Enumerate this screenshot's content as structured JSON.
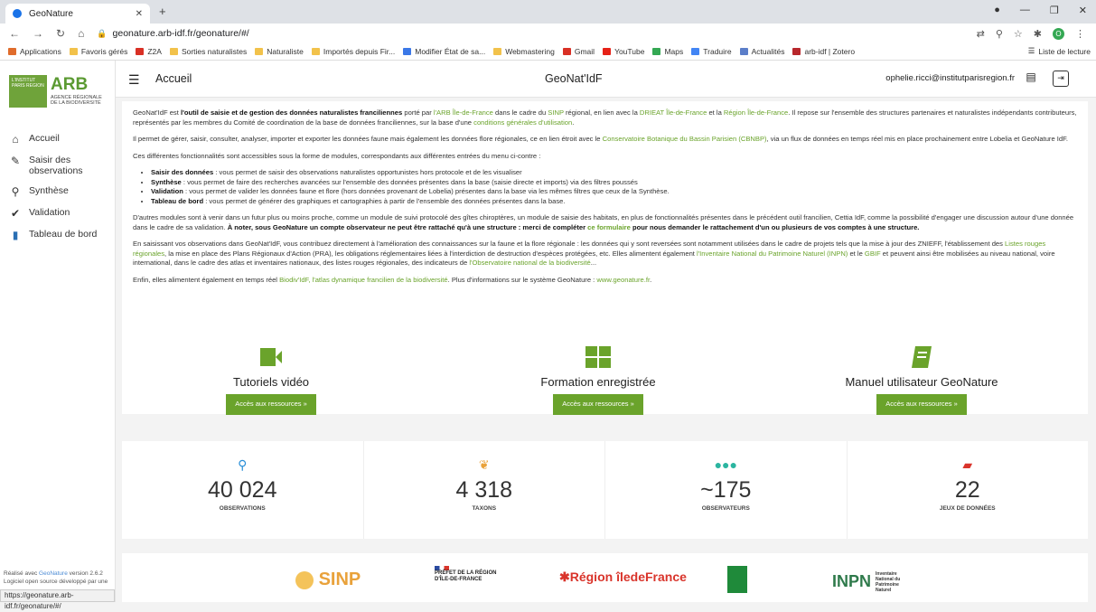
{
  "browser": {
    "tab_title": "GeoNature",
    "url": "geonature.arb-idf.fr/geonature/#/",
    "status_url": "https://geonature.arb-idf.fr/geonature/#/",
    "bookmarks": [
      "Applications",
      "Favoris gérés",
      "Z2A",
      "Sorties naturalistes",
      "Naturaliste",
      "Importés depuis Fir...",
      "Modifier État de sa...",
      "Webmastering",
      "Gmail",
      "YouTube",
      "Maps",
      "Traduire",
      "Actualités",
      "arb-idf | Zotero"
    ],
    "reading_list": "Liste de lecture"
  },
  "logo": {
    "box": "L'INSTITUT PARIS REGION",
    "arb": "ARB",
    "sub": "AGENCE RÉGIONALE DE LA BIODIVERSITÉ"
  },
  "menu": [
    "Accueil",
    "Saisir des observations",
    "Synthèse",
    "Validation",
    "Tableau de bord"
  ],
  "footer": {
    "line1_prefix": "Réalisé avec ",
    "line1_link": "GeoNature",
    "line1_suffix": " version 2.6.2",
    "line2": "Logiciel open source développé par une"
  },
  "topbar": {
    "crumb": "Accueil",
    "title": "GeoNat'IdF",
    "user": "ophelie.ricci@institutparisregion.fr"
  },
  "intro": {
    "p1a": "GeoNat'IdF est ",
    "p1b": "l'outil de saisie et de gestion des données naturalistes franciliennes",
    "p1c": " porté par ",
    "p1d": "l'ARB Île-de-France",
    "p1e": " dans le cadre du ",
    "p1f": "SINP",
    "p1g": " régional, en lien avec la ",
    "p1h": "DRIEAT Île-de-France",
    "p1i": " et la ",
    "p1j": "Région Île-de-France",
    "p1k": ". Il repose sur l'ensemble des structures partenaires et naturalistes indépendants contributeurs, représentés par les membres du Comité de coordination de la base de données franciliennes, sur la base d'une ",
    "p1l": "conditions générales d'utilisation",
    "p1m": ".",
    "p2a": "Il permet de gérer, saisir, consulter, analyser, importer et exporter les données faune mais également les données flore régionales, ce en lien étroit avec le ",
    "p2b": "Conservatoire Botanique du Bassin Parisien (CBNBP)",
    "p2c": ", via un flux de données en temps réel mis en place prochainement entre Lobelia et GeoNature IdF.",
    "p3": "Ces différentes fonctionnalités sont accessibles sous la forme de modules, correspondants aux différentes entrées du menu ci-contre :",
    "li": [
      [
        "Saisir des données",
        " : vous permet de saisir des observations naturalistes opportunistes hors protocole et de les visualiser"
      ],
      [
        "Synthèse",
        " : vous permet de faire des recherches avancées sur l'ensemble des données présentes dans la base (saisie directe et imports) via des filtres poussés"
      ],
      [
        "Validation",
        " : vous permet de valider les données faune et flore (hors données provenant de Lobelia) présentes dans la base via les mêmes filtres que ceux de la Synthèse."
      ],
      [
        "Tableau de bord",
        " : vous permet de générer des graphiques et cartographies à partir de l'ensemble des données présentes dans la base."
      ]
    ],
    "p4a": "D'autres modules sont à venir dans un futur plus ou moins proche, comme un module de suivi protocolé des gîtes chiroptères, un module de saisie des habitats, en plus de fonctionnalités présentes dans le précédent outil francilien, Cettia IdF, comme la possibilité d'engager une discussion autour d'une donnée dans le cadre de sa validation. ",
    "p4b": "À noter, sous GeoNature un compte observateur ne peut être rattaché qu'à une structure : merci de compléter ",
    "p4c": "ce formulaire",
    "p4d": " pour nous demander le rattachement d'un ou plusieurs de vos comptes à une structure.",
    "p5a": "En saisissant vos observations dans GeoNat'IdF, vous contribuez directement à l'amélioration des connaissances sur la faune et la flore régionale : les données qui y sont reversées sont notamment utilisées dans le cadre de projets tels que la mise à jour des ZNIEFF, l'établissement des ",
    "p5b": "Listes rouges régionales",
    "p5c": ", la mise en place des Plans Régionaux d'Action (PRA), les obligations réglementaires liées à l'interdiction de destruction d'espèces protégées, etc. Elles alimentent également ",
    "p5d": "l'Inventaire National du Patrimoine Naturel (INPN)",
    "p5e": " et le ",
    "p5f": "GBIF",
    "p5g": " et peuvent ainsi être mobilisées au niveau national, voire international, dans le cadre des atlas et inventaires nationaux, des listes rouges régionales, des indicateurs de ",
    "p5h": "l'Observatoire national de la biodiversité",
    "p5i": "...",
    "p6a": "Enfin, elles alimentent également en temps réel ",
    "p6b": "Biodiv'IdF, l'atlas dynamique francilien de la biodiversité",
    "p6c": ". Plus d'informations sur le système GeoNature : ",
    "p6d": "www.geonature.fr",
    "p6e": "."
  },
  "resources": [
    {
      "title": "Tutoriels vidéo",
      "button": "Accès aux ressources »",
      "icon": "video-icon"
    },
    {
      "title": "Formation enregistrée",
      "button": "Accès aux ressources »",
      "icon": "grid-icon"
    },
    {
      "title": "Manuel utilisateur GeoNature",
      "button": "Accès aux ressources »",
      "icon": "book-icon"
    }
  ],
  "stats": [
    {
      "value": "40 024",
      "label": "OBSERVATIONS",
      "icon": "search-icon",
      "color": "#2a8fd8"
    },
    {
      "value": "4 318",
      "label": "TAXONS",
      "icon": "leaf-icon",
      "color": "#e9a23b"
    },
    {
      "value": "~175",
      "label": "OBSERVATEURS",
      "icon": "users-icon",
      "color": "#2bb5a0"
    },
    {
      "value": "22",
      "label": "JEUX DE DONNÉES",
      "icon": "book-icon",
      "color": "#d9342b"
    }
  ],
  "partners": {
    "sinp": "SINP",
    "prefet": "PRÉFET DE LA RÉGION D'ÎLE-DE-FRANCE",
    "region_a": "Région",
    "region_b": "îledeFrance",
    "inpn": "INPN",
    "inpn_sub": "Inventaire National du Patrimoine Naturel"
  },
  "colors": {
    "accent": "#6aa32b"
  }
}
